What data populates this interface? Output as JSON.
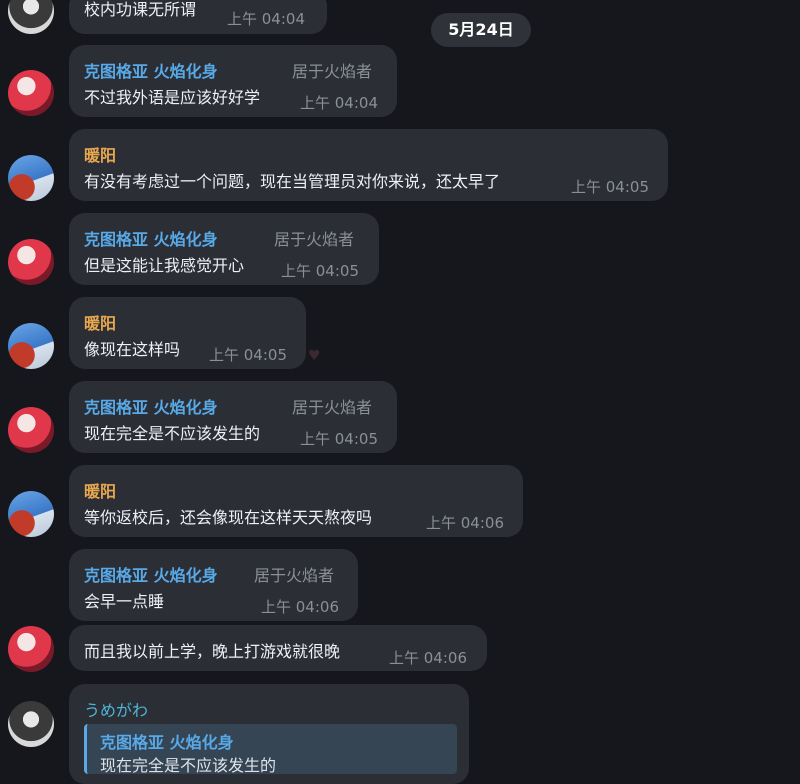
{
  "date_separator": "5月24日",
  "messages": [
    {
      "text": "校内功课无所谓",
      "time": "上午 04:04"
    },
    {
      "sender": "克图格亚 火焰化身",
      "role": "居于火焰者",
      "text": "不过我外语是应该好好学",
      "time": "上午 04:04"
    },
    {
      "sender": "暖阳",
      "text": "有没有考虑过一个问题，现在当管理员对你来说，还太早了",
      "time": "上午 04:05"
    },
    {
      "sender": "克图格亚 火焰化身",
      "role": "居于火焰者",
      "text": "但是这能让我感觉开心",
      "time": "上午 04:05"
    },
    {
      "sender": "暖阳",
      "text": "像现在这样吗",
      "time": "上午 04:05"
    },
    {
      "sender": "克图格亚 火焰化身",
      "role": "居于火焰者",
      "text": "现在完全是不应该发生的",
      "time": "上午 04:05"
    },
    {
      "sender": "暖阳",
      "text": "等你返校后，还会像现在这样天天熬夜吗",
      "time": "上午 04:06"
    },
    {
      "sender": "克图格亚 火焰化身",
      "role": "居于火焰者",
      "text": "会早一点睡",
      "time": "上午 04:06"
    },
    {
      "text": "而且我以前上学，晚上打游戏就很晚",
      "time": "上午 04:06"
    },
    {
      "sender": "うめがわ",
      "reply_sender": "克图格亚 火焰化身",
      "reply_text": "现在完全是不应该发生的"
    }
  ],
  "icons": {
    "avatar_red": "avatar-red-hair",
    "avatar_blue": "avatar-blue-sky",
    "avatar_gray": "avatar-dark-hair",
    "reaction": "heart-icon"
  },
  "colors": {
    "background": "#16171d",
    "bubble": "#2b2e35",
    "name_blue": "#58a9e8",
    "name_orange": "#e9a84f"
  }
}
